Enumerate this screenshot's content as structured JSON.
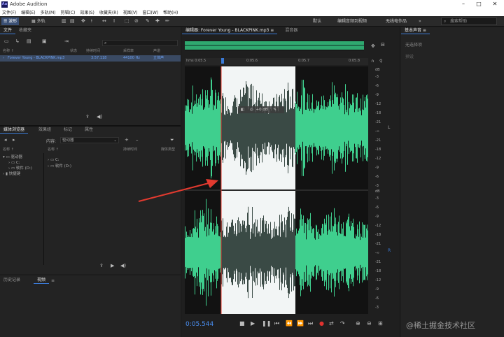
{
  "window": {
    "title": "Adobe Audition",
    "app_icon": "Au"
  },
  "menu": [
    "文件(F)",
    "编辑(E)",
    "多轨(M)",
    "剪辑(C)",
    "效果(S)",
    "收藏夹(R)",
    "视图(V)",
    "窗口(W)",
    "帮助(H)"
  ],
  "toolbar": {
    "waveform_label": "波形",
    "multitrack_label": "多轨",
    "workspaces": [
      "默认",
      "编辑音频到视频",
      "无线电作品"
    ],
    "search_placeholder": "搜索帮助"
  },
  "files_panel": {
    "tabs": [
      "文件",
      "收藏夹"
    ],
    "columns": [
      "名称 ↑",
      "状态",
      "持续时间",
      "采样率",
      "声道"
    ],
    "row": {
      "name": "Forever Young - BLACKPINK.mp3",
      "duration": "3:57.118",
      "rate": "44100 Hz",
      "channels": "立体声"
    }
  },
  "media_panel": {
    "tabs": [
      "媒体浏览器",
      "效果组",
      "标记",
      "属性"
    ],
    "content_label": "内容:",
    "content_value": "驱动器",
    "tree": [
      "驱动器",
      "C:",
      "软件 (D:)",
      "快捷键"
    ],
    "name_col": "名称 ↑",
    "duration_col": "持续时间",
    "media_type_col": "媒体类型",
    "list": [
      "C:",
      "软件 (D:)"
    ]
  },
  "history_panel": {
    "tabs": [
      "历史记录",
      "视频"
    ]
  },
  "editor": {
    "tabs": [
      "编辑器: Forever Young - BLACKPINK.mp3",
      "混音器"
    ],
    "ruler": [
      "hms 0:05.5",
      "0:05.6",
      "0:05.7",
      "0:05.8"
    ],
    "hud_value": "+0 dB",
    "db_label": "dB",
    "db_top": [
      "-3",
      "-6",
      "-9",
      "-12",
      "-18",
      "-21",
      "-∞",
      "-21",
      "-18",
      "-12",
      "-9",
      "-6",
      "-3"
    ],
    "db_bottom": [
      "-3",
      "-6",
      "-9",
      "-12",
      "-18",
      "-21",
      "-∞",
      "-21",
      "-18",
      "-12",
      "-9",
      "-6",
      "-3"
    ],
    "channel_top": "L",
    "channel_bottom": "R",
    "time": "0:05.544",
    "selection_color": "#f2f5f5",
    "wave_color": "#3fcf8e"
  },
  "right_panel": {
    "title": "基本声音",
    "line1": "无选择项",
    "line2": "预设"
  },
  "watermark": "@稀土掘金技术社区"
}
